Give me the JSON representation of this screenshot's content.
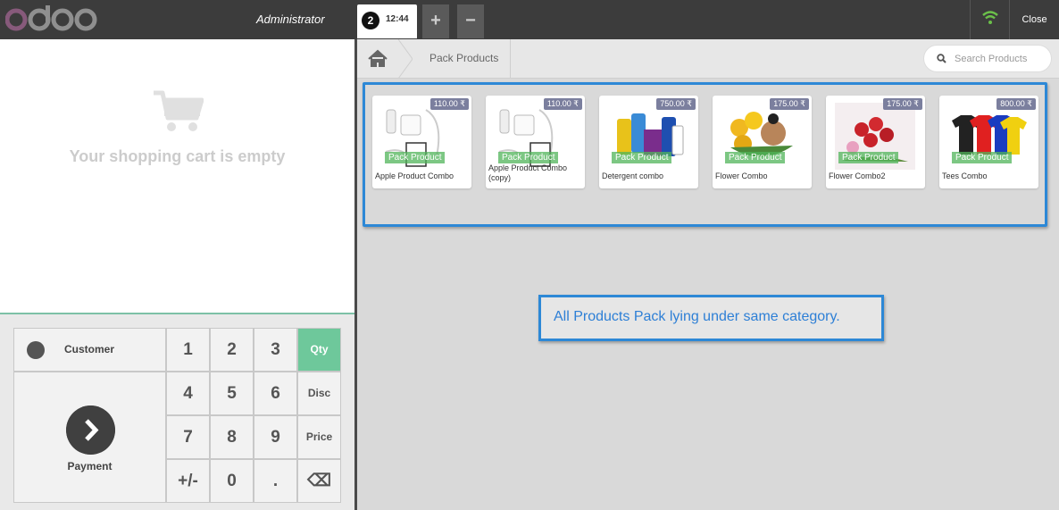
{
  "header": {
    "user": "Administrator",
    "order_number": "2",
    "order_time": "12:44",
    "add_label": "+",
    "remove_label": "−",
    "close_label": "Close"
  },
  "cart": {
    "empty_text": "Your shopping cart is empty"
  },
  "numpad": {
    "customer_label": "Customer",
    "payment_label": "Payment",
    "keys": [
      "1",
      "2",
      "3",
      "4",
      "5",
      "6",
      "7",
      "8",
      "9",
      "+/-",
      "0",
      "."
    ],
    "modes": [
      "Qty",
      "Disc",
      "Price"
    ],
    "backspace": "⌫",
    "active_mode": "Qty"
  },
  "breadcrumb": {
    "current": "Pack Products"
  },
  "search": {
    "placeholder": "Search Products"
  },
  "products": [
    {
      "name": "Apple Product Combo",
      "price": "110.00 ₹",
      "tag": "Pack Product"
    },
    {
      "name": "Apple Product Combo (copy)",
      "price": "110.00 ₹",
      "tag": "Pack Product"
    },
    {
      "name": "Detergent combo",
      "price": "750.00 ₹",
      "tag": "Pack Product"
    },
    {
      "name": "Flower Combo",
      "price": "175.00 ₹",
      "tag": "Pack Product"
    },
    {
      "name": "Flower Combo2",
      "price": "175.00 ₹",
      "tag": "Pack Product"
    },
    {
      "name": "Tees Combo",
      "price": "800.00 ₹",
      "tag": "Pack Product"
    }
  ],
  "annotation": "All Products Pack lying under same category.",
  "colors": {
    "topbar": "#3c3c3c",
    "logo": "#875a7b",
    "accent": "#6ec89b",
    "annotation": "#2d88d6",
    "price_badge": "#7b7f9e"
  }
}
